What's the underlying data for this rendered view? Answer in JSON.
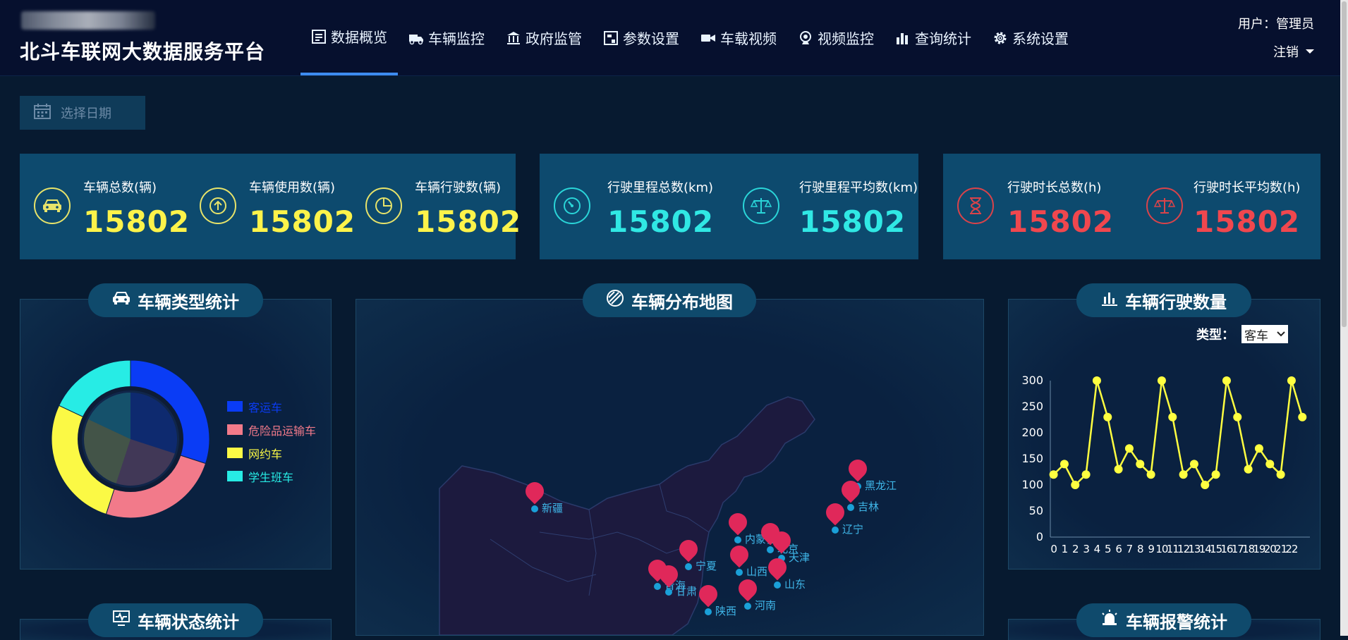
{
  "header": {
    "platform_title": "北斗车联网大数据服务平台",
    "nav": [
      {
        "label": "数据概览",
        "icon": "overview-icon",
        "active": true
      },
      {
        "label": "车辆监控",
        "icon": "truck-icon"
      },
      {
        "label": "政府监管",
        "icon": "government-icon"
      },
      {
        "label": "参数设置",
        "icon": "settings-form-icon"
      },
      {
        "label": "车载视频",
        "icon": "video-camera-icon"
      },
      {
        "label": "视频监控",
        "icon": "webcam-icon"
      },
      {
        "label": "查询统计",
        "icon": "bar-chart-icon"
      },
      {
        "label": "系统设置",
        "icon": "gear-icon"
      }
    ],
    "user_label": "用户：管理员",
    "logout_label": "注销"
  },
  "date_picker": {
    "placeholder": "选择日期"
  },
  "stats": [
    {
      "label": "车辆总数(辆)",
      "value": "15802",
      "icon": "car-icon"
    },
    {
      "label": "车辆使用数(辆)",
      "value": "15802",
      "icon": "upload-icon"
    },
    {
      "label": "车辆行驶数(辆)",
      "value": "15802",
      "icon": "pie-icon"
    },
    {
      "label": "行驶里程总数(km)",
      "value": "15802",
      "icon": "speedometer-icon"
    },
    {
      "label": "行驶里程平均数(km)",
      "value": "15802",
      "icon": "balance-scale-icon"
    },
    {
      "label": "行驶时长总数(h)",
      "value": "15802",
      "icon": "hourglass-icon"
    },
    {
      "label": "行驶时长平均数(h)",
      "value": "15802",
      "icon": "balance-scale-icon"
    }
  ],
  "colors": {
    "yellow": "#fdf34a",
    "cyan": "#30e8e4",
    "red": "#f0474e",
    "panel": "#0d4a6e"
  },
  "panels": {
    "vehicle_type": {
      "title": "车辆类型统计"
    },
    "distribution_map": {
      "title": "车辆分布地图"
    },
    "driving_count": {
      "title": "车辆行驶数量",
      "type_label": "类型：",
      "type_value": "客车"
    },
    "vehicle_status": {
      "title": "车辆状态统计"
    },
    "alarm": {
      "title": "车辆报警统计"
    }
  },
  "map_labels": [
    "新疆",
    "黑龙江",
    "吉林",
    "辽宁",
    "内蒙古",
    "北京",
    "天津",
    "宁夏",
    "山西",
    "山东",
    "青海",
    "甘肃",
    "陕西",
    "河南"
  ],
  "chart_data": [
    {
      "type": "pie",
      "categories": [
        "客运车",
        "危险品运输车",
        "网约车",
        "学生班车"
      ],
      "values": [
        30,
        25,
        27,
        18
      ],
      "colors": [
        "#0a3cf5",
        "#f27a8a",
        "#fbf945",
        "#27ece5"
      ]
    },
    {
      "type": "line",
      "x": [
        0,
        1,
        2,
        3,
        4,
        5,
        6,
        7,
        8,
        9,
        10,
        11,
        12,
        13,
        14,
        15,
        16,
        17,
        18,
        19,
        20,
        21,
        22,
        23
      ],
      "tick_labels": [
        "0",
        "1",
        "2",
        "3",
        "4",
        "5",
        "6",
        "7",
        "8",
        "9",
        "10",
        "11",
        "12",
        "13",
        "14",
        "15",
        "16",
        "17",
        "18",
        "19",
        "20",
        "21",
        "22"
      ],
      "values": [
        120,
        140,
        100,
        120,
        300,
        230,
        130,
        170,
        140,
        120,
        300,
        230,
        120,
        140,
        100,
        120,
        300,
        230,
        130,
        170,
        140,
        120,
        300,
        230
      ],
      "ylim": [
        0,
        300
      ],
      "yticks": [
        0,
        50,
        100,
        150,
        200,
        250,
        300
      ],
      "color": "#ffff40"
    }
  ]
}
